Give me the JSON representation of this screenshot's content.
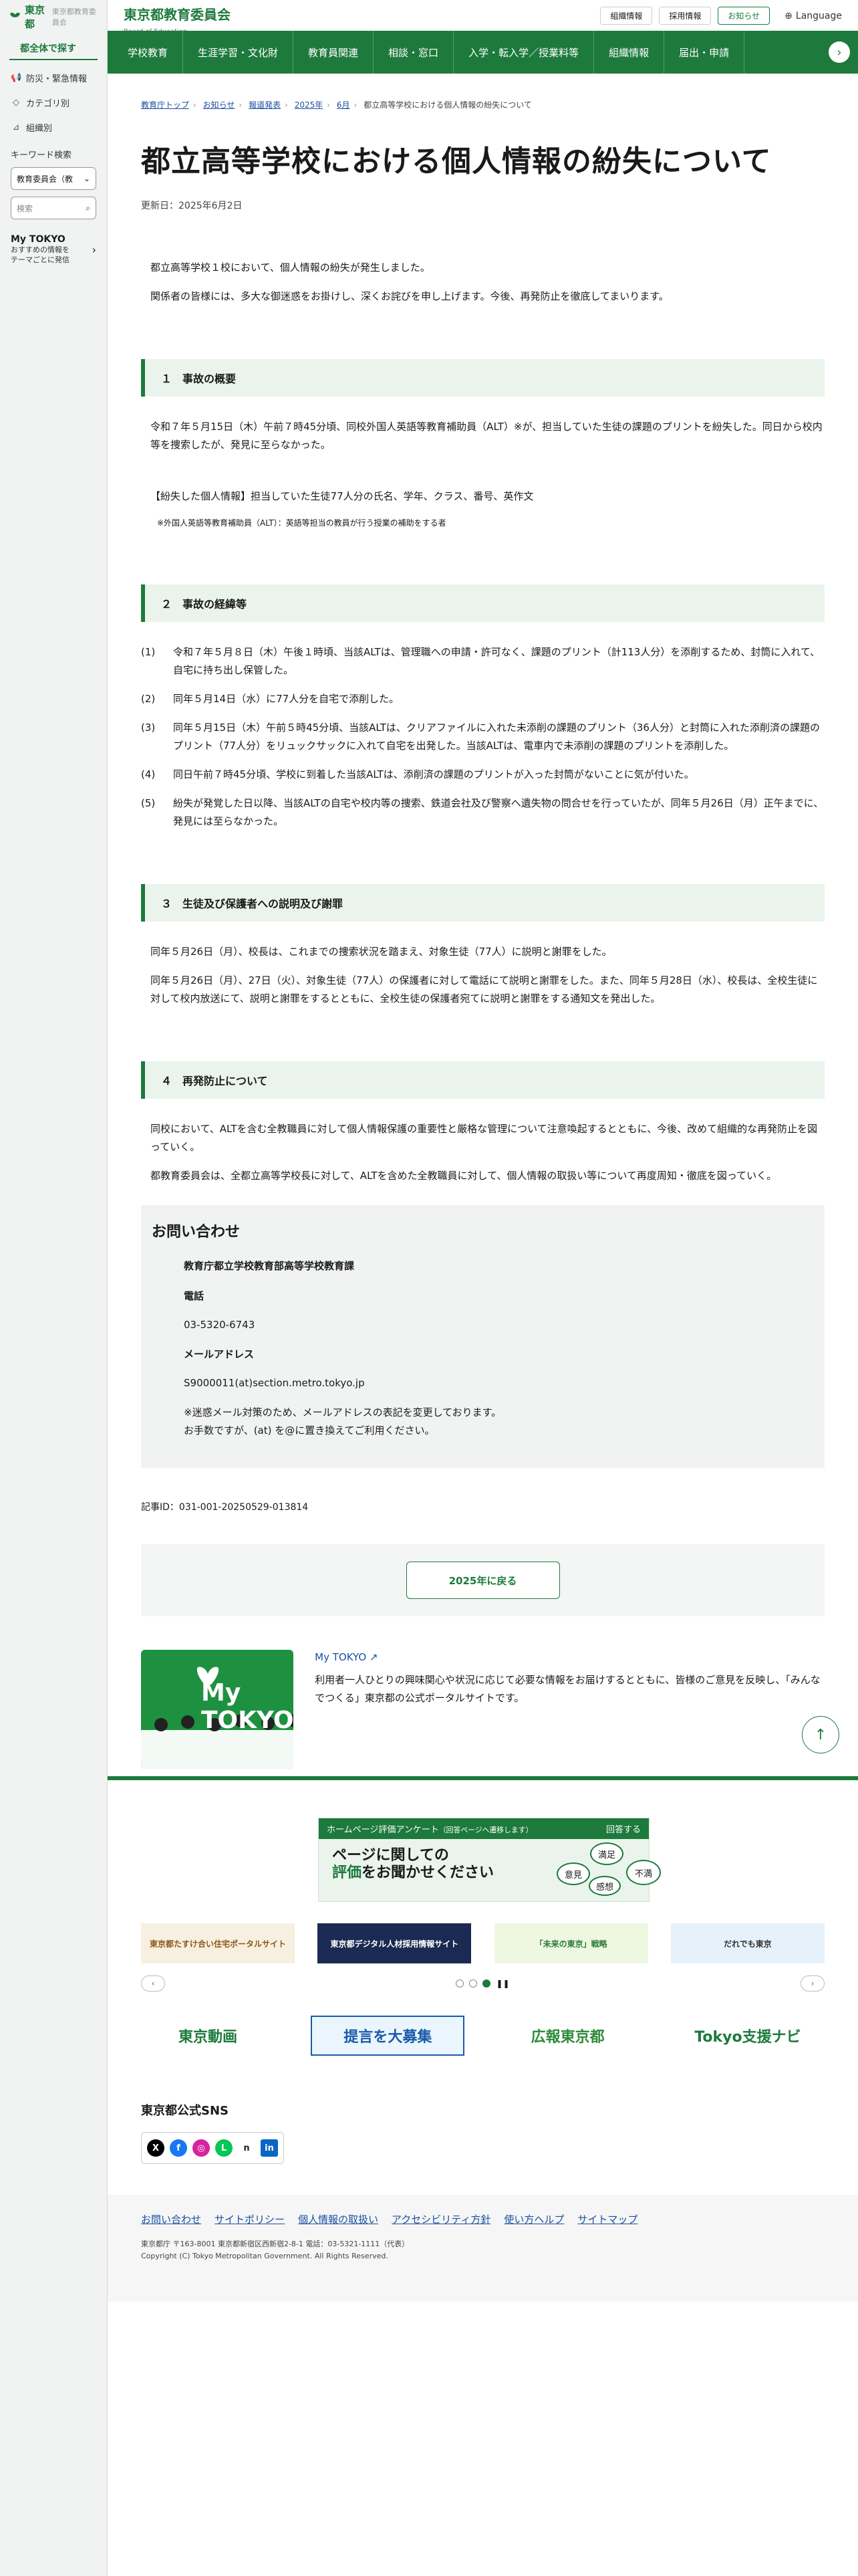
{
  "sidebar": {
    "logo_text": "東京都",
    "logo_sub": "東京都教育委員会",
    "heading": "都全体で探す",
    "items": [
      {
        "label": "防災・緊急情報",
        "icon": "megaphone-icon"
      },
      {
        "label": "カテゴリ別",
        "icon": "tag-icon"
      },
      {
        "label": "組織別",
        "icon": "org-chart-icon"
      }
    ],
    "keyword_label": "キーワード検索",
    "select_value": "教育委員会（教",
    "search_placeholder": "検索",
    "mytokyo_title": "My TOKYO",
    "mytokyo_desc1": "おすすめの情報を",
    "mytokyo_desc2": "テーマごとに発信"
  },
  "header": {
    "title": "東京都教育委員会",
    "subtitle": "Board of Education",
    "buttons": [
      "組織情報",
      "採用情報",
      "お知らせ"
    ],
    "language": "Language"
  },
  "nav": {
    "items": [
      "学校教育",
      "生涯学習・文化財",
      "教育員関連",
      "相談・窓口",
      "入学・転入学／授業料等",
      "組織情報",
      "届出・申請"
    ]
  },
  "breadcrumb": [
    "教育庁トップ",
    "お知らせ",
    "報道発表",
    "2025年",
    "6月",
    "都立高等学校における個人情報の紛失について"
  ],
  "page": {
    "title": "都立高等学校における個人情報の紛失について",
    "updated": "更新日：2025年6月2日",
    "intro1": "都立高等学校１校において、個人情報の紛失が発生しました。",
    "intro2": "関係者の皆様には、多大な御迷惑をお掛けし、深くお詫びを申し上げます。今後、再発防止を徹底してまいります。",
    "s1_title": "１　事故の概要",
    "s1_p1": "令和７年５月15日（木）午前７時45分頃、同校外国人英語等教育補助員（ALT）※が、担当していた生徒の課題のプリントを紛失した。同日から校内等を捜索したが、発見に至らなかった。",
    "s1_p2": "【紛失した個人情報】担当していた生徒77人分の氏名、学年、クラス、番号、英作文",
    "s1_note": "※外国人英語等教育補助員（ALT）：英語等担当の教員が行う授業の補助をする者",
    "s2_title": "２　事故の経緯等",
    "s2_items": [
      {
        "num": "(1)",
        "text": "令和７年５月８日（木）午後１時頃、当該ALTは、管理職への申請・許可なく、課題のプリント（計113人分）を添削するため、封筒に入れて、自宅に持ち出し保管した。"
      },
      {
        "num": "(2)",
        "text": "同年５月14日（水）に77人分を自宅で添削した。"
      },
      {
        "num": "(3)",
        "text": "同年５月15日（木）午前５時45分頃、当該ALTは、クリアファイルに入れた未添削の課題のプリント（36人分）と封筒に入れた添削済の課題のプリント（77人分）をリュックサックに入れて自宅を出発した。当該ALTは、電車内で未添削の課題のプリントを添削した。"
      },
      {
        "num": "(4)",
        "text": "同日午前７時45分頃、学校に到着した当該ALTは、添削済の課題のプリントが入った封筒がないことに気が付いた。"
      },
      {
        "num": "(5)",
        "text": "紛失が発覚した日以降、当該ALTの自宅や校内等の捜索、鉄道会社及び警察へ遺失物の問合せを行っていたが、同年５月26日（月）正午までに、発見には至らなかった。"
      }
    ],
    "s3_title": "３　生徒及び保護者への説明及び謝罪",
    "s3_p1": "同年５月26日（月）、校長は、これまでの捜索状況を踏まえ、対象生徒（77人）に説明と謝罪をした。",
    "s3_p2": "同年５月26日（月）、27日（火）、対象生徒（77人）の保護者に対して電話にて説明と謝罪をした。また、同年５月28日（水）、校長は、全校生徒に対して校内放送にて、説明と謝罪をするとともに、全校生徒の保護者宛てに説明と謝罪をする通知文を発出した。",
    "s4_title": "４　再発防止について",
    "s4_p1": "同校において、ALTを含む全教職員に対して個人情報保護の重要性と厳格な管理について注意喚起するとともに、今後、改めて組織的な再発防止を図っていく。",
    "s4_p2": "都教育委員会は、全都立高等学校長に対して、ALTを含めた全教職員に対して、個人情報の取扱い等について再度周知・徹底を図っていく。"
  },
  "contact": {
    "heading": "お問い合わせ",
    "dept": "教育庁都立学校教育部高等学校教育課",
    "tel_label": "電話",
    "tel": "03-5320-6743",
    "mail_label": "メールアドレス",
    "mail": "S9000011(at)section.metro.tokyo.jp",
    "note1": "※迷惑メール対策のため、メールアドレスの表記を変更しております。",
    "note2": "お手数ですが、(at) を@に置き換えてご利用ください。"
  },
  "article_id": "記事ID：031-001-20250529-013814",
  "back_button": "2025年に戻る",
  "promo": {
    "logo": "My TOKYO",
    "link": "My TOKYO",
    "desc": "利用者一人ひとりの興味関心や状況に応じて必要な情報をお届けするとともに、皆様のご意見を反映し、「みんなでつくる」東京都の公式ポータルサイトです。"
  },
  "survey": {
    "bar_left": "ホームページ評価アンケート",
    "bar_left_small": "（回答ページへ遷移します）",
    "bar_right": "回答する",
    "line1": "ページに関しての",
    "line2a": "評価",
    "line2b": "をお聞かせください",
    "bubbles": [
      "満足",
      "意見",
      "不満",
      "感想"
    ]
  },
  "banners": [
    {
      "label": "東京都たすけ合い住宅ポータルサイト",
      "color": "#f7efe0",
      "text_color": "#8a5a1a"
    },
    {
      "label": "東京都デジタル人材採用情報サイト",
      "color": "#1b2a52",
      "text_color": "#ffffff"
    },
    {
      "label": "「未来の東京」戦略",
      "color": "#eef7e0",
      "text_color": "#2b7a3a"
    },
    {
      "label": "だれでも東京",
      "color": "#e6f2fb",
      "text_color": "#333333"
    }
  ],
  "banners2": [
    {
      "label": "東京動画",
      "color": "#ffffff",
      "text_color": "#1d7a3c"
    },
    {
      "label": "提言を大募集",
      "color": "#eaf5fd",
      "text_color": "#1a5aa8"
    },
    {
      "label": "広報東京都",
      "color": "#ffffff",
      "text_color": "#2e8b3a"
    },
    {
      "label": "Tokyo支援ナビ",
      "color": "#ffffff",
      "text_color": "#1d7a3c"
    }
  ],
  "sns": {
    "heading": "東京都公式SNS",
    "icons": [
      {
        "name": "x-icon",
        "glyph": "X",
        "color": "#000000"
      },
      {
        "name": "facebook-icon",
        "glyph": "f",
        "color": "#1877f2"
      },
      {
        "name": "instagram-icon",
        "glyph": "◎",
        "color": "#d6249f"
      },
      {
        "name": "line-icon",
        "glyph": "L",
        "color": "#06c755"
      },
      {
        "name": "note-icon",
        "glyph": "n",
        "color": "#222222"
      },
      {
        "name": "linkedin-icon",
        "glyph": "in",
        "color": "#0a66c2"
      }
    ]
  },
  "footer": {
    "links": [
      "お問い合わせ",
      "サイトポリシー",
      "個人情報の取扱い",
      "アクセシビリティ方針",
      "使い方ヘルプ",
      "サイトマップ"
    ],
    "address": "東京都庁 〒163-8001 東京都新宿区西新宿2-8-1 電話：03-5321-1111（代表）",
    "copyright": "Copyright (C) Tokyo Metropolitan Government. All Rights Reserved."
  },
  "colors": {
    "brand_green": "#1d7a3c",
    "section_bg": "#eaf4ec"
  }
}
